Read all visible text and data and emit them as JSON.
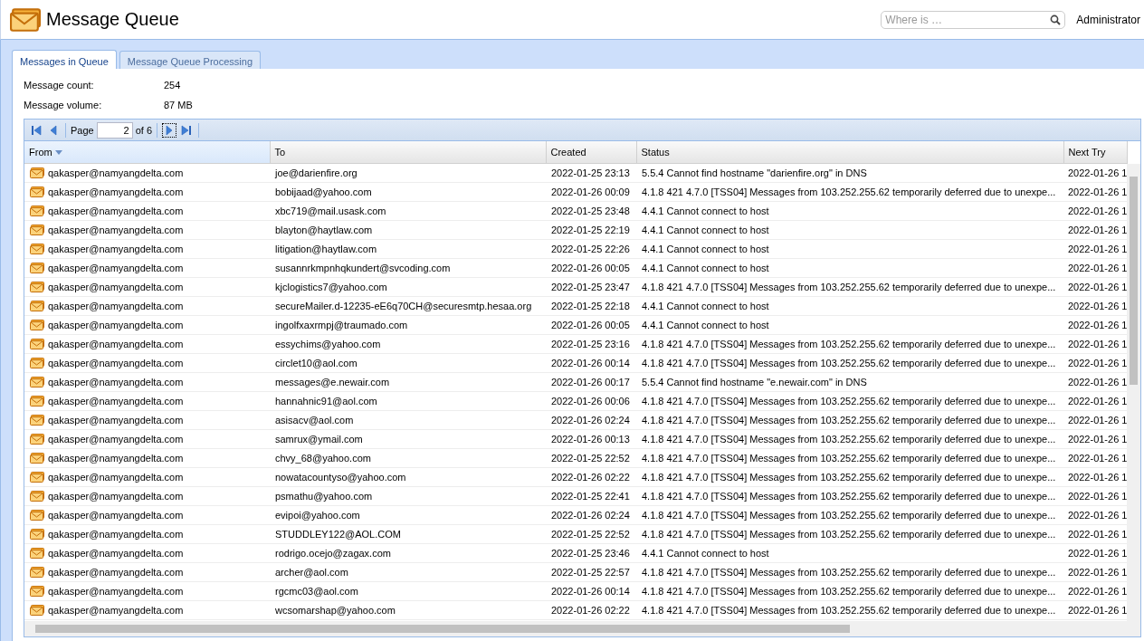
{
  "header": {
    "title": "Message Queue",
    "search": {
      "placeholder": "Where is …"
    },
    "user": "Administrator"
  },
  "tabs": [
    {
      "label": "Messages in Queue",
      "selected": true
    },
    {
      "label": "Message Queue Processing",
      "selected": false
    }
  ],
  "summary": [
    {
      "label": "Message count:",
      "value": "254"
    },
    {
      "label": "Message volume:",
      "value": "87 MB"
    }
  ],
  "pager": {
    "label": "Page",
    "page": "2",
    "of": "of 6"
  },
  "table": {
    "columns": [
      {
        "label": "From",
        "sorted": true
      },
      {
        "label": "To",
        "sorted": false
      },
      {
        "label": "Created",
        "sorted": false
      },
      {
        "label": "Status",
        "sorted": false
      },
      {
        "label": "Next Try",
        "sorted": false
      }
    ],
    "rows": [
      {
        "from": "qakasper@namyangdelta.com",
        "to": "joe@darienfire.org",
        "created": "2022-01-25 23:13",
        "status": "5.5.4 Cannot find hostname \"darienfire.org\" in DNS",
        "next_try": "2022-01-26 1"
      },
      {
        "from": "qakasper@namyangdelta.com",
        "to": "bobijaad@yahoo.com",
        "created": "2022-01-26 00:09",
        "status": "4.1.8 421 4.7.0 [TSS04] Messages from 103.252.255.62 temporarily deferred due to unexpe...",
        "next_try": "2022-01-26 1"
      },
      {
        "from": "qakasper@namyangdelta.com",
        "to": "xbc719@mail.usask.com",
        "created": "2022-01-25 23:48",
        "status": "4.4.1 Cannot connect to host",
        "next_try": "2022-01-26 1"
      },
      {
        "from": "qakasper@namyangdelta.com",
        "to": "blayton@haytlaw.com",
        "created": "2022-01-25 22:19",
        "status": "4.4.1 Cannot connect to host",
        "next_try": "2022-01-26 1"
      },
      {
        "from": "qakasper@namyangdelta.com",
        "to": "litigation@haytlaw.com",
        "created": "2022-01-25 22:26",
        "status": "4.4.1 Cannot connect to host",
        "next_try": "2022-01-26 1"
      },
      {
        "from": "qakasper@namyangdelta.com",
        "to": "susannrkmpnhqkundert@svcoding.com",
        "created": "2022-01-26 00:05",
        "status": "4.4.1 Cannot connect to host",
        "next_try": "2022-01-26 1"
      },
      {
        "from": "qakasper@namyangdelta.com",
        "to": "kjclogistics7@yahoo.com",
        "created": "2022-01-25 23:47",
        "status": "4.1.8 421 4.7.0 [TSS04] Messages from 103.252.255.62 temporarily deferred due to unexpe...",
        "next_try": "2022-01-26 1"
      },
      {
        "from": "qakasper@namyangdelta.com",
        "to": "secureMailer.d-12235-eE6q70CH@securesmtp.hesaa.org",
        "created": "2022-01-25 22:18",
        "status": "4.4.1 Cannot connect to host",
        "next_try": "2022-01-26 1"
      },
      {
        "from": "qakasper@namyangdelta.com",
        "to": "ingolfxaxrmpj@traumado.com",
        "created": "2022-01-26 00:05",
        "status": "4.4.1 Cannot connect to host",
        "next_try": "2022-01-26 1"
      },
      {
        "from": "qakasper@namyangdelta.com",
        "to": "essychims@yahoo.com",
        "created": "2022-01-25 23:16",
        "status": "4.1.8 421 4.7.0 [TSS04] Messages from 103.252.255.62 temporarily deferred due to unexpe...",
        "next_try": "2022-01-26 1"
      },
      {
        "from": "qakasper@namyangdelta.com",
        "to": "circlet10@aol.com",
        "created": "2022-01-26 00:14",
        "status": "4.1.8 421 4.7.0 [TSS04] Messages from 103.252.255.62 temporarily deferred due to unexpe...",
        "next_try": "2022-01-26 1"
      },
      {
        "from": "qakasper@namyangdelta.com",
        "to": "messages@e.newair.com",
        "created": "2022-01-26 00:17",
        "status": "5.5.4 Cannot find hostname \"e.newair.com\" in DNS",
        "next_try": "2022-01-26 1"
      },
      {
        "from": "qakasper@namyangdelta.com",
        "to": "hannahnic91@aol.com",
        "created": "2022-01-26 00:06",
        "status": "4.1.8 421 4.7.0 [TSS04] Messages from 103.252.255.62 temporarily deferred due to unexpe...",
        "next_try": "2022-01-26 1"
      },
      {
        "from": "qakasper@namyangdelta.com",
        "to": "asisacv@aol.com",
        "created": "2022-01-26 02:24",
        "status": "4.1.8 421 4.7.0 [TSS04] Messages from 103.252.255.62 temporarily deferred due to unexpe...",
        "next_try": "2022-01-26 1"
      },
      {
        "from": "qakasper@namyangdelta.com",
        "to": "samrux@ymail.com",
        "created": "2022-01-26 00:13",
        "status": "4.1.8 421 4.7.0 [TSS04] Messages from 103.252.255.62 temporarily deferred due to unexpe...",
        "next_try": "2022-01-26 1"
      },
      {
        "from": "qakasper@namyangdelta.com",
        "to": "chvy_68@yahoo.com",
        "created": "2022-01-25 22:52",
        "status": "4.1.8 421 4.7.0 [TSS04] Messages from 103.252.255.62 temporarily deferred due to unexpe...",
        "next_try": "2022-01-26 1"
      },
      {
        "from": "qakasper@namyangdelta.com",
        "to": "nowatacountyso@yahoo.com",
        "created": "2022-01-26 02:22",
        "status": "4.1.8 421 4.7.0 [TSS04] Messages from 103.252.255.62 temporarily deferred due to unexpe...",
        "next_try": "2022-01-26 1"
      },
      {
        "from": "qakasper@namyangdelta.com",
        "to": "psmathu@yahoo.com",
        "created": "2022-01-25 22:41",
        "status": "4.1.8 421 4.7.0 [TSS04] Messages from 103.252.255.62 temporarily deferred due to unexpe...",
        "next_try": "2022-01-26 1"
      },
      {
        "from": "qakasper@namyangdelta.com",
        "to": "evipoi@yahoo.com",
        "created": "2022-01-26 02:24",
        "status": "4.1.8 421 4.7.0 [TSS04] Messages from 103.252.255.62 temporarily deferred due to unexpe...",
        "next_try": "2022-01-26 1"
      },
      {
        "from": "qakasper@namyangdelta.com",
        "to": "STUDDLEY122@AOL.COM",
        "created": "2022-01-25 22:52",
        "status": "4.1.8 421 4.7.0 [TSS04] Messages from 103.252.255.62 temporarily deferred due to unexpe...",
        "next_try": "2022-01-26 1"
      },
      {
        "from": "qakasper@namyangdelta.com",
        "to": "rodrigo.ocejo@zagax.com",
        "created": "2022-01-25 23:46",
        "status": "4.4.1 Cannot connect to host",
        "next_try": "2022-01-26 1"
      },
      {
        "from": "qakasper@namyangdelta.com",
        "to": "archer@aol.com",
        "created": "2022-01-25 22:57",
        "status": "4.1.8 421 4.7.0 [TSS04] Messages from 103.252.255.62 temporarily deferred due to unexpe...",
        "next_try": "2022-01-26 1"
      },
      {
        "from": "qakasper@namyangdelta.com",
        "to": "rgcmc03@aol.com",
        "created": "2022-01-26 00:14",
        "status": "4.1.8 421 4.7.0 [TSS04] Messages from 103.252.255.62 temporarily deferred due to unexpe...",
        "next_try": "2022-01-26 1"
      },
      {
        "from": "qakasper@namyangdelta.com",
        "to": "wcsomarshap@yahoo.com",
        "created": "2022-01-26 02:22",
        "status": "4.1.8 421 4.7.0 [TSS04] Messages from 103.252.255.62 temporarily deferred due to unexpe...",
        "next_try": "2022-01-26 1"
      }
    ]
  }
}
